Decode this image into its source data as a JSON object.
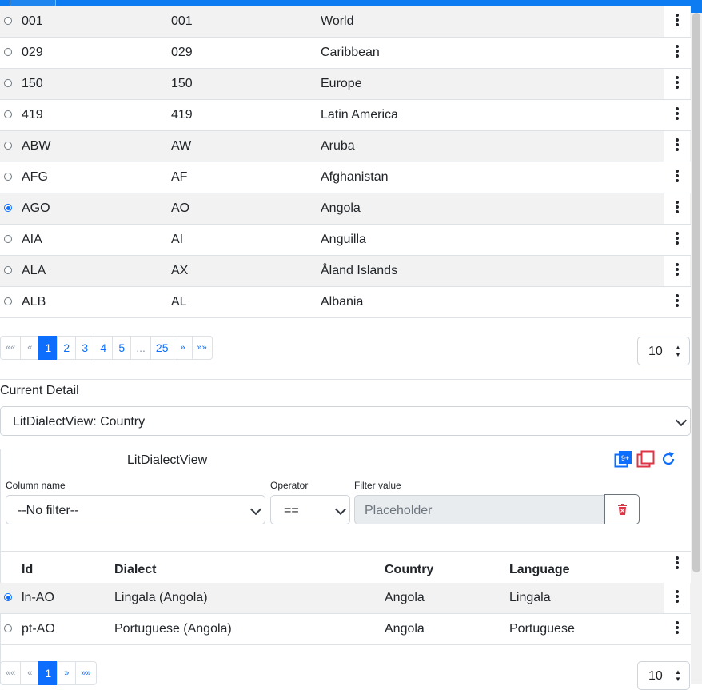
{
  "app_bar": {
    "color": "#0d7cf2"
  },
  "main_table": {
    "rows": [
      {
        "code3": "001",
        "code2": "001",
        "name": "World",
        "selected": false
      },
      {
        "code3": "029",
        "code2": "029",
        "name": "Caribbean",
        "selected": false
      },
      {
        "code3": "150",
        "code2": "150",
        "name": "Europe",
        "selected": false
      },
      {
        "code3": "419",
        "code2": "419",
        "name": "Latin America",
        "selected": false
      },
      {
        "code3": "ABW",
        "code2": "AW",
        "name": "Aruba",
        "selected": false
      },
      {
        "code3": "AFG",
        "code2": "AF",
        "name": "Afghanistan",
        "selected": false
      },
      {
        "code3": "AGO",
        "code2": "AO",
        "name": "Angola",
        "selected": true
      },
      {
        "code3": "AIA",
        "code2": "AI",
        "name": "Anguilla",
        "selected": false
      },
      {
        "code3": "ALA",
        "code2": "AX",
        "name": "Åland Islands",
        "selected": false
      },
      {
        "code3": "ALB",
        "code2": "AL",
        "name": "Albania",
        "selected": false
      }
    ],
    "pagination": [
      "««",
      "«",
      "1",
      "2",
      "3",
      "4",
      "5",
      "...",
      "25",
      "»",
      "»»"
    ],
    "active_page": "1",
    "page_size": "10"
  },
  "current_detail": {
    "label": "Current Detail",
    "selected": "LitDialectView: Country"
  },
  "dialect_view": {
    "title": "LitDialectView",
    "icons": [
      "copy-badge-icon",
      "copy-icon",
      "refresh-icon"
    ],
    "filter": {
      "column_label": "Column name",
      "column_value": "--No filter--",
      "operator_label": "Operator",
      "operator_value": "==",
      "value_label": "Filter value",
      "value_placeholder": "Placeholder"
    },
    "columns": [
      "Id",
      "Dialect",
      "Country",
      "Language"
    ],
    "rows": [
      {
        "id": "ln-AO",
        "dialect": "Lingala (Angola)",
        "country": "Angola",
        "language": "Lingala",
        "selected": true
      },
      {
        "id": "pt-AO",
        "dialect": "Portuguese (Angola)",
        "country": "Angola",
        "language": "Portuguese",
        "selected": false
      }
    ],
    "pagination": [
      "««",
      "«",
      "1",
      "»",
      "»»"
    ],
    "active_page": "1",
    "page_size": "10"
  },
  "colors": {
    "accent": "#0d6efd",
    "danger": "#dc3545",
    "stripe": "#f2f2f2"
  }
}
